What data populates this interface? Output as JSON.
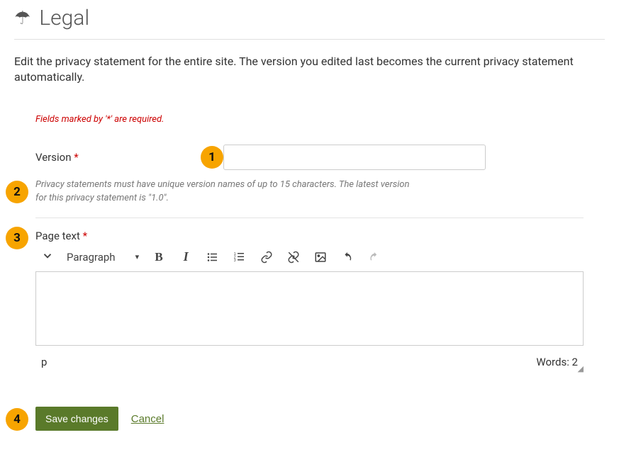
{
  "header": {
    "title": "Legal",
    "icon": "umbrella-icon"
  },
  "description": "Edit the privacy statement for the entire site. The version you edited last becomes the current privacy statement automatically.",
  "form": {
    "required_note": "Fields marked by '*' are required.",
    "version": {
      "label": "Version",
      "value": "",
      "help": "Privacy statements must have unique version names of up to 15 characters. The latest version for this privacy statement is \"1.0\"."
    },
    "page_text": {
      "label": "Page text"
    }
  },
  "editor": {
    "format_select": "Paragraph",
    "footer_path": "p",
    "word_count_label": "Words: 2"
  },
  "actions": {
    "save": "Save changes",
    "cancel": "Cancel"
  },
  "callouts": {
    "c1": "1",
    "c2": "2",
    "c3": "3",
    "c4": "4"
  }
}
